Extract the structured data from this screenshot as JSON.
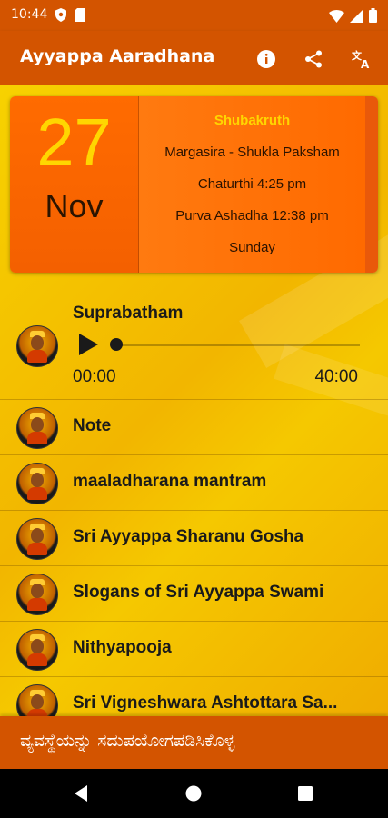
{
  "status_bar": {
    "time": "10:44",
    "icons_left": [
      "shield-icon",
      "sd-card-icon"
    ],
    "icons_right": [
      "wifi-icon",
      "signal-icon",
      "battery-icon"
    ]
  },
  "app_bar": {
    "title": "Ayyappa Aaradhana",
    "actions": [
      "info-icon",
      "share-icon",
      "translate-icon"
    ],
    "color": "#d35400"
  },
  "calendar": {
    "day": "27",
    "month": "Nov",
    "year_name": "Shubakruth",
    "masa_paksha": "Margasira - Shukla Paksham",
    "tithi": "Chaturthi 4:25 pm",
    "nakshatra": "Purva Ashadha 12:38 pm",
    "weekday": "Sunday"
  },
  "player": {
    "title": "Suprabatham",
    "current_time": "00:00",
    "total_time": "40:00",
    "progress": 0
  },
  "items": [
    {
      "label": "Note"
    },
    {
      "label": "maaladharana mantram"
    },
    {
      "label": "Sri Ayyappa Sharanu Gosha"
    },
    {
      "label": "Slogans of Sri Ayyappa Swami"
    },
    {
      "label": "Nithyapooja"
    },
    {
      "label": "Sri Vigneshwara Ashtottara Sa..."
    }
  ],
  "banner": {
    "text": "ವ್ಯವಸ್ಥೆಯನ್ನು ಸದುಪಯೋಗಪಡಿಸಿಕೊಳ್ಳ"
  },
  "nav_bar": {
    "buttons": [
      "back-icon",
      "home-icon",
      "recents-icon"
    ]
  }
}
